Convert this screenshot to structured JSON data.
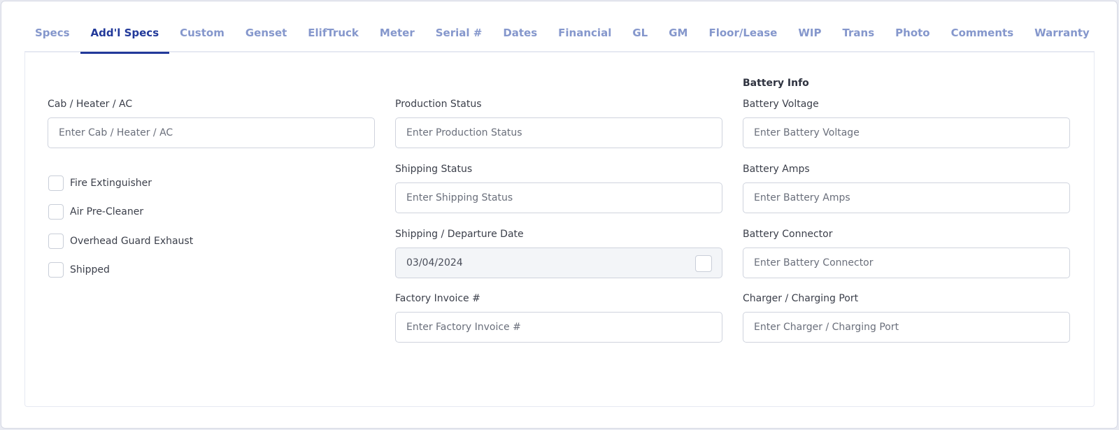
{
  "tabs": [
    {
      "label": "Specs"
    },
    {
      "label": "Add'l Specs",
      "active": true
    },
    {
      "label": "Custom"
    },
    {
      "label": "Genset"
    },
    {
      "label": "ElifTruck"
    },
    {
      "label": "Meter"
    },
    {
      "label": "Serial #"
    },
    {
      "label": "Dates"
    },
    {
      "label": "Financial"
    },
    {
      "label": "GL"
    },
    {
      "label": "GM"
    },
    {
      "label": "Floor/Lease"
    },
    {
      "label": "WIP"
    },
    {
      "label": "Trans"
    },
    {
      "label": "Photo"
    },
    {
      "label": "Comments"
    },
    {
      "label": "Warranty"
    }
  ],
  "left": {
    "cab_label": "Cab / Heater / AC",
    "cab_placeholder": "Enter Cab / Heater / AC",
    "checkboxes": [
      {
        "label": "Fire Extinguisher",
        "checked": false
      },
      {
        "label": "Air Pre-Cleaner",
        "checked": false
      },
      {
        "label": "Overhead Guard Exhaust",
        "checked": false
      },
      {
        "label": "Shipped",
        "checked": false
      }
    ]
  },
  "middle": {
    "production_label": "Production Status",
    "production_placeholder": "Enter Production Status",
    "shipping_label": "Shipping Status",
    "shipping_placeholder": "Enter Shipping Status",
    "departure_label": "Shipping / Departure Date",
    "departure_value": "03/04/2024",
    "invoice_label": "Factory Invoice #",
    "invoice_placeholder": "Enter Factory Invoice #"
  },
  "right": {
    "section_title": "Battery Info",
    "voltage_label": "Battery Voltage",
    "voltage_placeholder": "Enter Battery Voltage",
    "amps_label": "Battery Amps",
    "amps_placeholder": "Enter Battery Amps",
    "connector_label": "Battery Connector",
    "connector_placeholder": "Enter Battery Connector",
    "charger_label": "Charger / Charging Port",
    "charger_placeholder": "Enter Charger / Charging Port"
  },
  "colors": {
    "tab_active": "#22399a",
    "tab_inactive": "#8597cc",
    "border": "#cfd3dd",
    "readonly_bg": "#f3f5f8"
  }
}
